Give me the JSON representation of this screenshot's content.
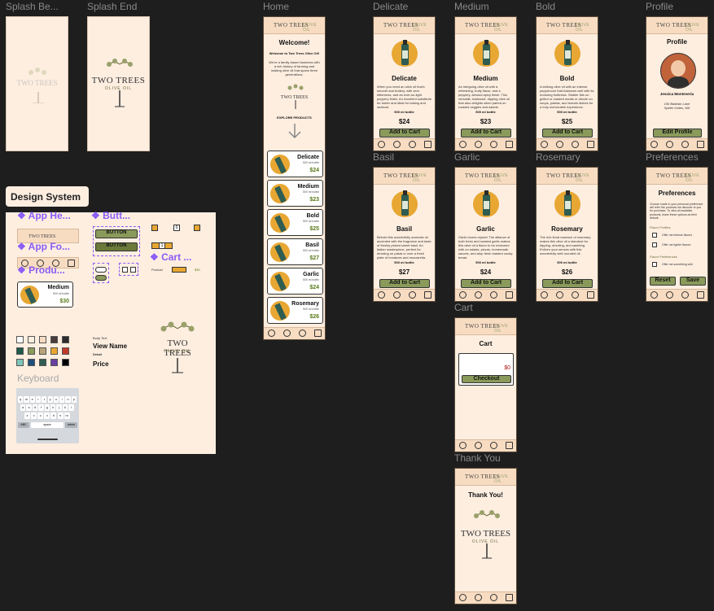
{
  "frame_labels": {
    "splash_begin": "Splash Be...",
    "splash_end": "Splash End",
    "home": "Home",
    "delicate": "Delicate",
    "medium": "Medium",
    "bold": "Bold",
    "profile": "Profile",
    "basil": "Basil",
    "garlic": "Garlic",
    "rosemary": "Rosemary",
    "preferences": "Preferences",
    "cart": "Cart",
    "thank_you": "Thank You",
    "design_system": "Design System",
    "keyboard": "Keyboard"
  },
  "brand": {
    "name": "TWO TREES",
    "sub": "OLIVE OIL",
    "header_logo": "TWO TREES",
    "header_sub": "OLIVE OIL"
  },
  "home": {
    "title": "Welcome!",
    "subtitle": "Welcome to Two Trees Olive Oil!",
    "body": "We're a family-based business with a rich history of farming and making olive oil that spans three generations.",
    "explore": "EXPLORE PRODUCTS",
    "products": [
      {
        "name": "Delicate",
        "size": "500 ml bottle",
        "price": "$24"
      },
      {
        "name": "Medium",
        "size": "500 ml bottle",
        "price": "$23"
      },
      {
        "name": "Bold",
        "size": "500 ml bottle",
        "price": "$25"
      },
      {
        "name": "Basil",
        "size": "500 ml bottle",
        "price": "$27"
      },
      {
        "name": "Garlic",
        "size": "500 ml bottle",
        "price": "$24"
      },
      {
        "name": "Rosemary",
        "size": "500 ml bottle",
        "price": "$26"
      }
    ]
  },
  "product_pages": [
    {
      "name": "Delicate",
      "desc": "When you need an olive oil that's smooth and buttery, with zero bitterness, and an ever-so-light peppery finish. An excellent substitute for butter and ideal for baking and seafood.",
      "size": "500 ml bottle",
      "price": "$24",
      "cta": "Add to Cart"
    },
    {
      "name": "Medium",
      "desc": "An intriguing olive oil with a refreshing, fruity flavor, and a peppery, almond-spicy finish. This versatile, balanced, dipping olive oil that also delights when paired on roasted veggies and salads.",
      "size": "500 ml bottle",
      "price": "$23",
      "cta": "Add to Cart"
    },
    {
      "name": "Bold",
      "desc": "A striking olive oil with an intense peppercorn that balances well with its enduring fruitiness. Slather this on grilled or roasted meats or drizzle on soups, pastas, and tomato dishes for a truly memorable experience.",
      "size": "500 ml bottle",
      "price": "$25",
      "cta": "Add to Cart"
    },
    {
      "name": "Basil",
      "desc": "Behold this wonderfully aromatic oil accented with the fragrance and taste of freshly picked sweet basil. An Italian masterpiece, perfect for drizzling on pasta or over a fresh plate of tomatoes and mozzarella.",
      "size": "500 ml bottle",
      "price": "$27",
      "cta": "Add to Cart"
    },
    {
      "name": "Garlic",
      "desc": "Garlic lovers rejoice! The alliance of both fresh and roasted garlic makes this olive oil a flavor to be reckoned with on salads, pizzas, homemade sauces, and atop fresh toasted crusty bread.",
      "size": "500 ml bottle",
      "price": "$24",
      "cta": "Add to Cart"
    },
    {
      "name": "Rosemary",
      "desc": "The rich floral essence of rosemary makes this olive oil a standout for dipping, drizzling, and sautéing. Enliven your senses with this wonderfully well-rounded oil.",
      "size": "500 ml bottle",
      "price": "$26",
      "cta": "Add to Cart"
    }
  ],
  "profile": {
    "title": "Profile",
    "name": "Jessica Monteveria",
    "address_1": "150 Baldwin Lane",
    "address_2": "Spider Gates, MA",
    "cta": "Edit Profile"
  },
  "preferences": {
    "title": "Preferences",
    "intro": "Choose made in your personal preference will refer the products we discover to you for purchase. To view all available products, leave these options as their default.",
    "flavor_heading": "Flavor Profiles",
    "flavor_opts": [
      "Offer me intense flavors",
      "Offer me lighter flavors"
    ],
    "flavor_prefs_heading": "Flavor Preferences",
    "flavor_prefs_opts": [
      "Offer me something wild"
    ],
    "reset": "Reset",
    "save": "Save"
  },
  "cart": {
    "title": "Cart",
    "total": "$0",
    "cta": "Checkout"
  },
  "thank_you": {
    "title": "Thank You!"
  },
  "design_system": {
    "app_header": "App He...",
    "app_footer": "App Fo...",
    "product": "Produ...",
    "buttons": "Butt...",
    "cart_comp": "Cart ...",
    "button_label_1": "BUTTON",
    "button_label_2": "BUTTON",
    "card": {
      "name": "Medium",
      "size": "500 ml bottle",
      "price": "$30"
    },
    "cart_row_label": "Product",
    "cart_row_price": "$30",
    "stepper_value": "0",
    "stepper_value_2": "1",
    "type_body": "Body Text",
    "type_view": "View Name",
    "type_detail": "Detail",
    "type_price": "Price",
    "colors": [
      "#ffffff",
      "#fdeee0",
      "#f7dcc2",
      "#4a3b3b",
      "#2b2b2b",
      "#1f5a4a",
      "#8a9a5b",
      "#b9a47a",
      "#e8a732",
      "#c0392b",
      "#7fc4b8",
      "#1f4e79",
      "#2f5d52",
      "#6a3fa0",
      "#000000"
    ]
  },
  "keyboard": {
    "row1": [
      "q",
      "w",
      "e",
      "r",
      "t",
      "y",
      "u",
      "i",
      "o",
      "p"
    ],
    "row2": [
      "a",
      "s",
      "d",
      "f",
      "g",
      "h",
      "j",
      "k",
      "l"
    ],
    "row3": [
      "z",
      "x",
      "c",
      "v",
      "b",
      "n",
      "m"
    ],
    "space": "space",
    "abc": "ABC",
    "return": "return"
  }
}
